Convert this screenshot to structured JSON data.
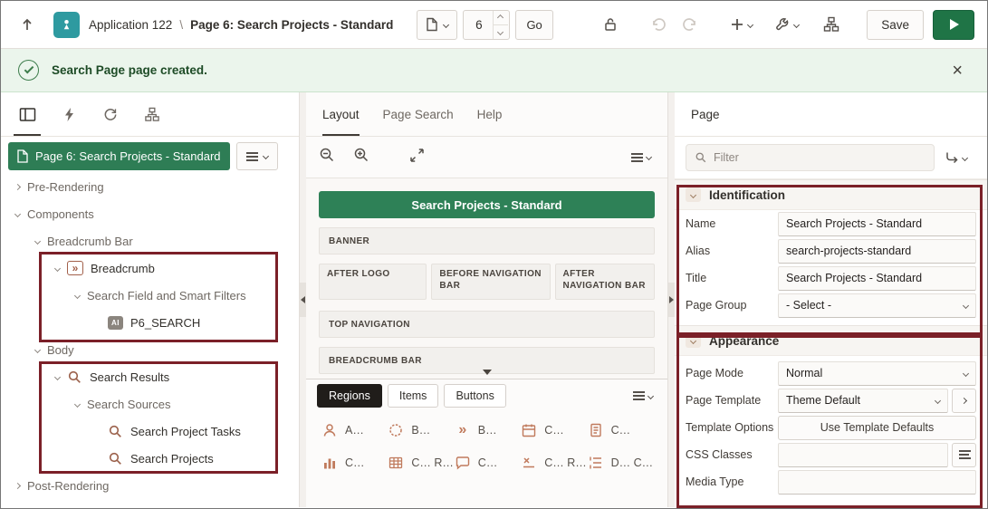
{
  "colors": {
    "accent_green": "#2E7D55",
    "annotation_red": "#7B2028",
    "icon_orange": "#C07A5C",
    "app_teal": "#2E9AA0",
    "success_bg": "#EBF5EC"
  },
  "icons": {
    "breadcrumb_glyph": "»",
    "ai_glyph": "AI",
    "close_glyph": "×"
  },
  "header": {
    "app_label": "Application 122",
    "separator": "\\",
    "page_label": "Page 6: Search Projects - Standard",
    "page_number": "6",
    "go_button": "Go",
    "save_button": "Save"
  },
  "banner": {
    "message": "Search Page page created."
  },
  "left_panel": {
    "page_node_label": "Page 6: Search Projects - Standard",
    "tree": [
      {
        "label": "Pre-Rendering"
      },
      {
        "label": "Components"
      },
      {
        "label": "Breadcrumb Bar"
      },
      {
        "label": "Breadcrumb"
      },
      {
        "label": "Search Field and Smart Filters"
      },
      {
        "label": "P6_SEARCH"
      },
      {
        "label": "Body"
      },
      {
        "label": "Search Results"
      },
      {
        "label": "Search Sources"
      },
      {
        "label": "Search Project Tasks"
      },
      {
        "label": "Search Projects"
      },
      {
        "label": "Post-Rendering"
      }
    ]
  },
  "center": {
    "tabs": {
      "layout": "Layout",
      "page_search": "Page Search",
      "help": "Help"
    },
    "canvas": {
      "page_title": "Search Projects - Standard",
      "banner": "BANNER",
      "after_logo": "AFTER LOGO",
      "before_nav": "BEFORE NAVIGATION BAR",
      "after_nav": "AFTER NAVIGATION BAR",
      "top_nav": "TOP NAVIGATION",
      "breadcrumb_bar": "BREADCRUMB BAR"
    },
    "gallery": {
      "tabs": {
        "regions": "Regions",
        "items": "Items",
        "buttons": "Buttons"
      },
      "items": [
        {
          "label": "A…"
        },
        {
          "label": "B…"
        },
        {
          "label": "B…"
        },
        {
          "label": "C…"
        },
        {
          "label": "C…"
        },
        {
          "label": "C…"
        },
        {
          "label": "C… R…"
        },
        {
          "label": "C…"
        },
        {
          "label": "C… R…"
        },
        {
          "label": "D… C…"
        }
      ]
    }
  },
  "right_panel": {
    "tab_label": "Page",
    "filter_placeholder": "Filter",
    "identification": {
      "title": "Identification",
      "name_label": "Name",
      "name_value": "Search Projects - Standard",
      "alias_label": "Alias",
      "alias_value": "search-projects-standard",
      "title_label": "Title",
      "title_value": "Search Projects - Standard",
      "page_group_label": "Page Group",
      "page_group_value": "- Select -"
    },
    "appearance": {
      "title": "Appearance",
      "page_mode_label": "Page Mode",
      "page_mode_value": "Normal",
      "page_template_label": "Page Template",
      "page_template_value": "Theme Default",
      "template_options_label": "Template Options",
      "template_options_button": "Use Template Defaults",
      "css_classes_label": "CSS Classes",
      "css_classes_value": "",
      "media_type_label": "Media Type",
      "media_type_value": ""
    }
  }
}
